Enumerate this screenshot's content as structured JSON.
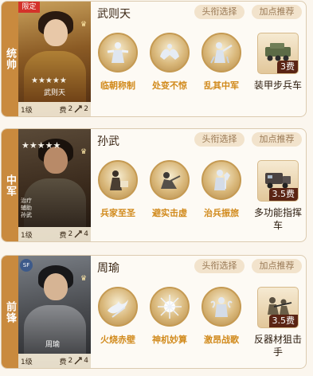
{
  "buttons": {
    "title_select": "头衔选择",
    "recommend": "加点推荐"
  },
  "heroes": [
    {
      "role": "统帅",
      "name": "武则天",
      "badge": "限定",
      "caption": "武则天",
      "level": "1级",
      "cost_label": "费",
      "cost_value": "2",
      "troop_value": "2",
      "stars": "★★★★★",
      "skills": [
        "临朝称制",
        "处变不惊",
        "乱其中军"
      ],
      "skill_icons": [
        "robed-figure-icon",
        "hands-open-icon",
        "general-command-icon"
      ],
      "item": {
        "name": "装甲步兵车",
        "cost": "3费",
        "icon": "armored-vehicle-icon"
      }
    },
    {
      "role": "中军",
      "name": "孙武",
      "tags": [
        "治疗",
        "辅助"
      ],
      "caption": "孙武",
      "level": "1级",
      "cost_label": "费",
      "cost_value": "2",
      "troop_value": "4",
      "stars": "★★★★★",
      "skills": [
        "兵家至圣",
        "避实击虚",
        "治兵振旅"
      ],
      "skill_icons": [
        "sage-writing-icon",
        "crouching-soldier-icon",
        "armored-warrior-icon"
      ],
      "item": {
        "name": "多功能指挥车",
        "cost": "3.5费",
        "icon": "command-vehicle-icon"
      }
    },
    {
      "role": "前锋",
      "name": "周瑜",
      "sf": "SF",
      "caption": "周瑜",
      "level": "1级",
      "cost_label": "费",
      "cost_value": "2",
      "troop_value": "4",
      "skills": [
        "火烧赤壁",
        "神机妙算",
        "激昂战歌"
      ],
      "skill_icons": [
        "fire-bird-icon",
        "light-burst-icon",
        "war-song-icon"
      ],
      "item": {
        "name": "反器材狙击手",
        "cost": "3.5费",
        "icon": "sniper-icon"
      }
    }
  ],
  "colors": {
    "accent": "#c98a3e",
    "skill_text": "#d18a1c",
    "button_bg": "#f2e3cc"
  }
}
